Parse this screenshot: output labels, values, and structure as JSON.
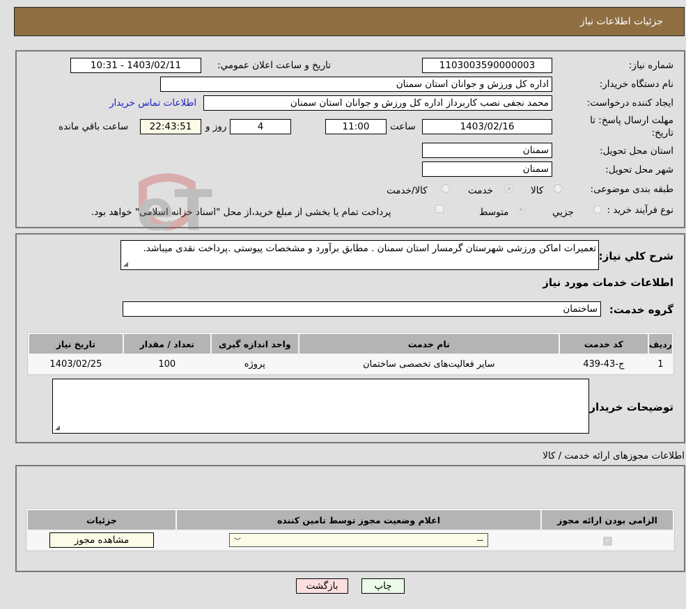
{
  "header": {
    "title": "جزئیات اطلاعات نیاز"
  },
  "form": {
    "need_number": {
      "label": "شماره نیاز:",
      "value": "1103003590000003"
    },
    "announce_datetime": {
      "label": "تاریخ و ساعت اعلان عمومي:",
      "value": "1403/02/11 - 10:31"
    },
    "buyer_org": {
      "label": "نام دستگاه خريدار:",
      "value": "اداره کل ورزش و جوانان استان سمنان"
    },
    "requester": {
      "label": "ايجاد کننده درخواست:",
      "value": "محمد نجفی نصب کاربرداز اداره کل ورزش و جوانان استان سمنان"
    },
    "buyer_contact_link": "اطلاعات تماس خريدار",
    "deadline": {
      "label_line1": "مهلت ارسال پاسخ: تا",
      "label_line2": "تاريخ:",
      "date": "1403/02/16",
      "time_label": "ساعت",
      "time": "11:00",
      "days": "4",
      "days_label": "روز و",
      "remaining": "22:43:51",
      "remaining_label": "ساعت باقي مانده"
    },
    "delivery_province": {
      "label": "استان محل تحويل:",
      "value": "سمنان"
    },
    "delivery_city": {
      "label": "شهر محل تحويل:",
      "value": "سمنان"
    },
    "category": {
      "label": "طبقه بندی موضوعی:",
      "options": [
        "کالا",
        "خدمت",
        "کالا/خدمت"
      ],
      "selected": "خدمت"
    },
    "purchase_type": {
      "label": "نوع فرآيند خريد :",
      "options": [
        "جزيي",
        "متوسط"
      ],
      "selected": "متوسط",
      "treasury_note": "پرداخت تمام يا بخشی از مبلغ خريد،از محل \"اسناد خزانه اسلامی\" خواهد بود."
    }
  },
  "description": {
    "label": "شرح کلي نياز:",
    "value": "تعميرات اماکن ورزشی شهرستان گرمسار استان سمنان . مطابق برآورد و مشخصات پیوستی .پرداخت نقدی میباشد."
  },
  "services": {
    "section_title": "اطلاعات خدمات مورد نياز",
    "group_label": "گروه خدمت:",
    "group_value": "ساختمان",
    "table": {
      "headers": [
        "رديف",
        "کد خدمت",
        "نام خدمت",
        "واحد اندازه گيری",
        "تعداد / مقدار",
        "تاريخ نياز"
      ],
      "rows": [
        [
          "1",
          "ج-43-439",
          "ساير فعاليت‌هاى تخصصى ساختمان",
          "پروژه",
          "100",
          "1403/02/25"
        ]
      ]
    },
    "buyer_notes_label": "توضيحات خريدار:",
    "buyer_notes_value": ""
  },
  "permits": {
    "section_title": "اطلاعات مجوزهای ارائه خدمت / کالا",
    "headers": [
      "الزامی بودن ارائه مجوز",
      "اعلام وضعيت مجوز توسط تامين کننده",
      "جزئيات"
    ],
    "row": {
      "required": true,
      "status_selected": "--",
      "details_button": "مشاهده مجوز"
    }
  },
  "buttons": {
    "print": "چاپ",
    "back": "بازگشت"
  },
  "watermark": "AriaTender.neT"
}
